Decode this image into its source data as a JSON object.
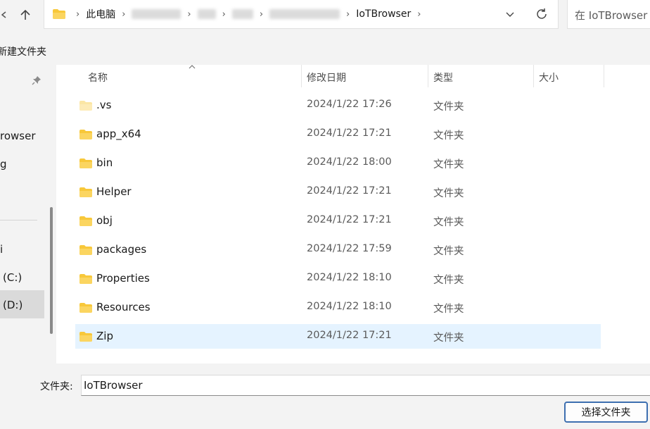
{
  "address_bar": {
    "crumbs": [
      "此电脑",
      "IoTBrowser"
    ],
    "blurred_crumb_count": 4
  },
  "search": {
    "placeholder": "在 IoTBrowser 中搜索"
  },
  "command_bar": {
    "new_folder_label": "新建文件夹"
  },
  "nav_pane": {
    "items": [
      {
        "label": "rowser"
      },
      {
        "label": "g"
      },
      {
        "label": "i"
      },
      {
        "label": "(C:)"
      },
      {
        "label": "(D:)",
        "selected": true
      }
    ]
  },
  "columns": {
    "name": "名称",
    "date": "修改日期",
    "type": "类型",
    "size": "大小"
  },
  "files": [
    {
      "name": ".vs",
      "date": "2024/1/22 17:26",
      "type": "文件夹",
      "hidden": true
    },
    {
      "name": "app_x64",
      "date": "2024/1/22 17:21",
      "type": "文件夹"
    },
    {
      "name": "bin",
      "date": "2024/1/22 18:00",
      "type": "文件夹"
    },
    {
      "name": "Helper",
      "date": "2024/1/22 17:21",
      "type": "文件夹"
    },
    {
      "name": "obj",
      "date": "2024/1/22 17:21",
      "type": "文件夹"
    },
    {
      "name": "packages",
      "date": "2024/1/22 17:59",
      "type": "文件夹"
    },
    {
      "name": "Properties",
      "date": "2024/1/22 18:10",
      "type": "文件夹"
    },
    {
      "name": "Resources",
      "date": "2024/1/22 18:10",
      "type": "文件夹"
    },
    {
      "name": "Zip",
      "date": "2024/1/22 17:21",
      "type": "文件夹",
      "selected": true
    }
  ],
  "footer": {
    "folder_label": "文件夹:",
    "folder_value": "IoTBrowser",
    "select_button": "选择文件夹"
  },
  "colors": {
    "folder": "#f8c83a",
    "selection": "#e5f3ff",
    "accent": "#3d6fb0"
  }
}
